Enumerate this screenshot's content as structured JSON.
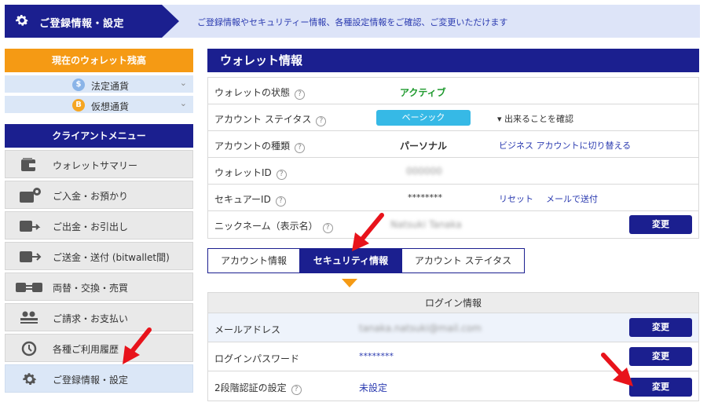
{
  "header": {
    "title": "ご登録情報・設定",
    "description": "ご登録情報やセキュリティー情報、各種設定情報をご確認、ご変更いただけます"
  },
  "sidebar": {
    "balance_title": "現在のウォレット残高",
    "currencies": [
      {
        "label": "法定通貨",
        "icon": "dollar-coin-icon",
        "symbol": "$",
        "color": "#8ab4e8"
      },
      {
        "label": "仮想通貨",
        "icon": "bitcoin-icon",
        "symbol": "B",
        "color": "#f5a623"
      }
    ],
    "menu_title": "クライアントメニュー",
    "menu_items": [
      {
        "label": "ウォレットサマリー",
        "icon": "wallet-icon"
      },
      {
        "label": "ご入金・お預かり",
        "icon": "deposit-icon"
      },
      {
        "label": "ご出金・お引出し",
        "icon": "withdraw-icon"
      },
      {
        "label": "ご送金・送付 (bitwallet間)",
        "icon": "transfer-icon"
      },
      {
        "label": "両替・交換・売買",
        "icon": "exchange-icon"
      },
      {
        "label": "ご請求・お支払い",
        "icon": "users-icon"
      },
      {
        "label": "各種ご利用履歴",
        "icon": "history-icon"
      },
      {
        "label": "ご登録情報・設定",
        "icon": "gear-icon",
        "active": true
      }
    ]
  },
  "wallet": {
    "title": "ウォレット情報",
    "rows": {
      "status": {
        "key": "ウォレットの状態",
        "value": "アクティブ"
      },
      "account_status": {
        "key": "アカウント ステイタス",
        "badge": "ベーシック",
        "link": "出来ることを確認"
      },
      "account_type": {
        "key": "アカウントの種類",
        "value": "パーソナル",
        "link": "ビジネス アカウントに切り替える"
      },
      "wallet_id": {
        "key": "ウォレットID",
        "value": "000000"
      },
      "secure_id": {
        "key": "セキュアーID",
        "value": "********",
        "reset": "リセット",
        "send_mail": "メールで送付"
      },
      "nickname": {
        "key": "ニックネーム（表示名）",
        "value": "Natsuki Tanaka",
        "button": "変更"
      }
    }
  },
  "tabs": {
    "account": "アカウント情報",
    "security": "セキュリティ情報",
    "status": "アカウント ステイタス"
  },
  "login": {
    "title": "ログイン情報",
    "email": {
      "key": "メールアドレス",
      "value": "tanaka.natsuki@mail.com",
      "button": "変更"
    },
    "password": {
      "key": "ログインパスワード",
      "value": "********",
      "button": "変更"
    },
    "two_factor": {
      "key": "2段階認証の設定",
      "value": "未設定",
      "button": "変更"
    }
  },
  "colors": {
    "navy": "#1b1f8f",
    "orange": "#f59a14",
    "green": "#1f9a2e",
    "badge": "#36b9e6",
    "arrow": "#e8131b"
  }
}
